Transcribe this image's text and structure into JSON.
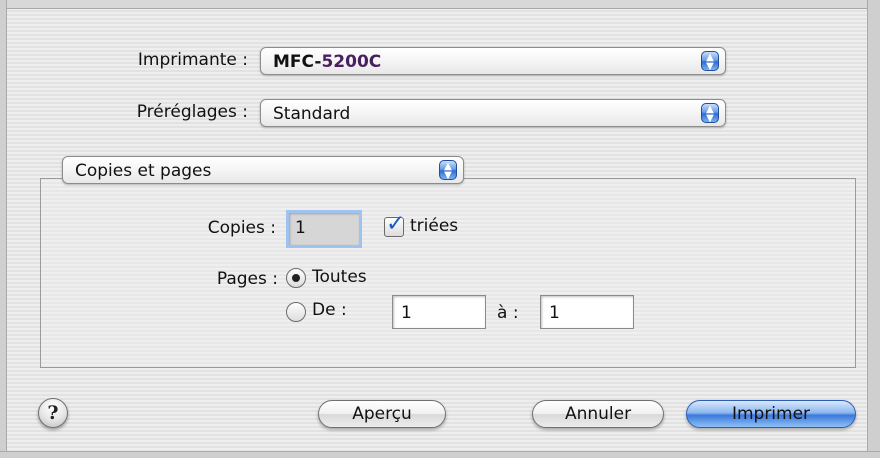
{
  "printer": {
    "label": "Imprimante :",
    "value_prefix": "MFC-",
    "value_number": "5200C"
  },
  "presets": {
    "label": "Préréglages :",
    "value": "Standard"
  },
  "panel": {
    "value": "Copies et pages"
  },
  "copies": {
    "label": "Copies :",
    "value": "1",
    "collate_label": "triées",
    "collate_checked": true
  },
  "pages": {
    "label": "Pages :",
    "all_label": "Toutes",
    "all_selected": true,
    "from_label": "De :",
    "from_value": "1",
    "to_label": "à :",
    "to_value": "1"
  },
  "buttons": {
    "help": "?",
    "preview": "Aperçu",
    "cancel": "Annuler",
    "print": "Imprimer"
  },
  "icons": {
    "popup_arrows": "up-down-arrows-icon",
    "checkmark": "checkmark-icon",
    "radio_dot": "radio-dot-icon",
    "help": "question-mark-icon"
  },
  "colors": {
    "accent_blue": "#3c7adb",
    "printer_number": "#4a1f60",
    "focus_ring": "#9ec3ee"
  }
}
